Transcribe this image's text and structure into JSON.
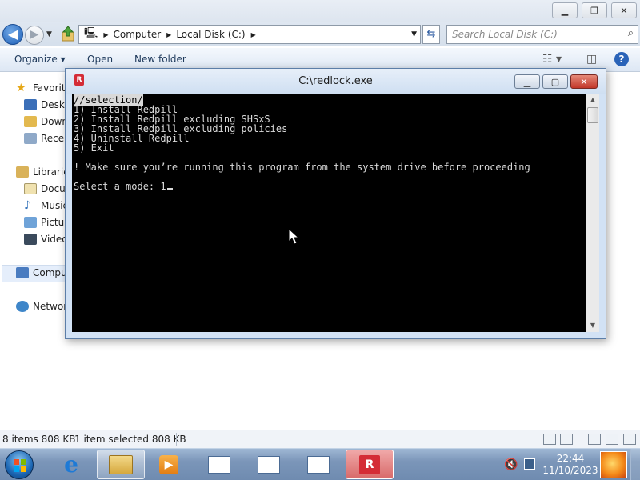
{
  "explorer": {
    "breadcrumb": [
      "Computer",
      "Local Disk (C:)"
    ],
    "search_placeholder": "Search Local Disk (C:)",
    "toolbar": {
      "organize": "Organize ▾",
      "open": "Open",
      "new_folder": "New folder"
    },
    "nav": {
      "favorites": "Favorites",
      "desktop": "Desktop",
      "downloads": "Downloads",
      "recent": "Recent Places",
      "libraries": "Libraries",
      "documents": "Documents",
      "music": "Music",
      "pictures": "Pictures",
      "videos": "Videos",
      "computer": "Computer",
      "network": "Network"
    },
    "status": {
      "items": "8 items 808 KB",
      "selected": "1 item selected 808 KB"
    }
  },
  "console": {
    "title": "C:\\redlock.exe",
    "menu_header": "//selection/",
    "options": [
      "1) Install Redpill",
      "2) Install Redpill excluding SHSxS",
      "3) Install Redpill excluding policies",
      "4) Uninstall Redpill",
      "5) Exit"
    ],
    "warning": "! Make sure you’re running this program from the system drive before proceeding",
    "prompt": "Select a mode: ",
    "input_value": "1"
  },
  "taskbar": {
    "time": "22:44",
    "date": "11/10/2023",
    "app_icon_letter": "R"
  },
  "colors": {
    "console_bg": "#000000",
    "console_fg": "#d9d9d9",
    "close_red": "#c2372a",
    "taskbar_blue": "#7b96b9"
  }
}
